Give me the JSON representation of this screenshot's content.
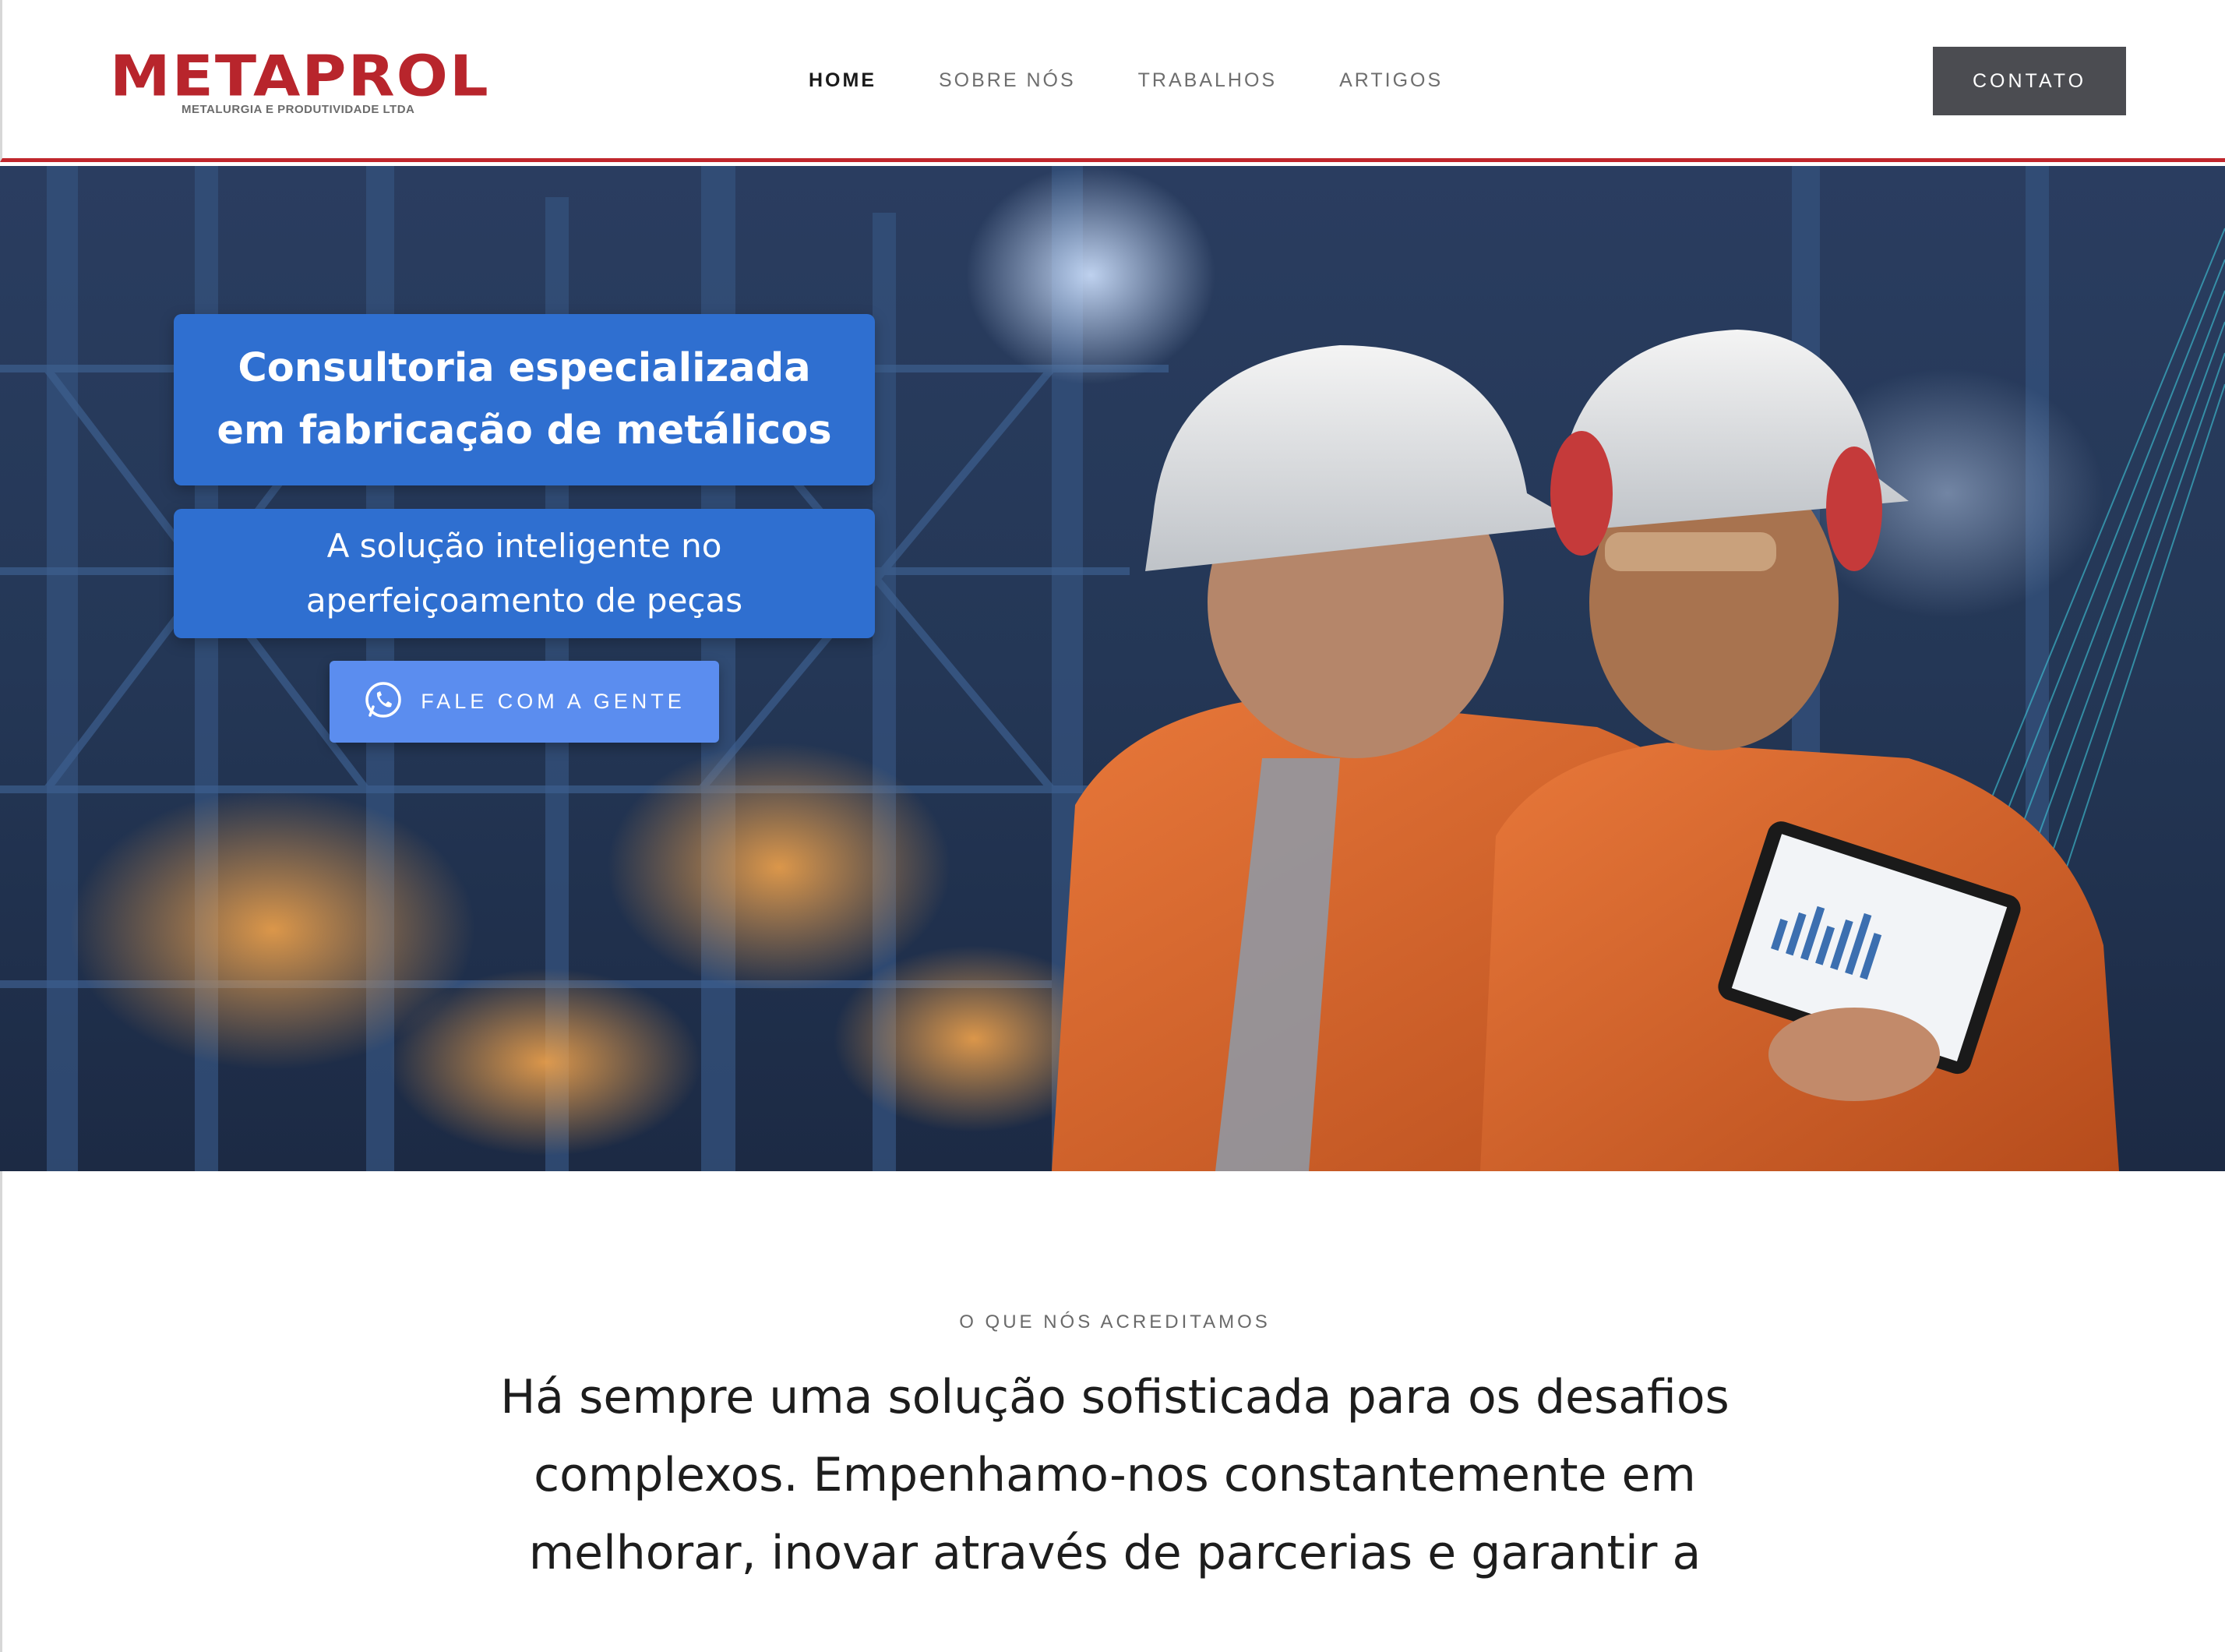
{
  "header": {
    "logo_text": "METAPROL",
    "logo_subtitle": "METALURGIA E PRODUTIVIDADE LTDA",
    "nav": [
      {
        "label": "HOME",
        "active": true
      },
      {
        "label": "SOBRE NÓS",
        "active": false
      },
      {
        "label": "TRABALHOS",
        "active": false
      },
      {
        "label": "ARTIGOS",
        "active": false
      }
    ],
    "contact_label": "CONTATO"
  },
  "hero": {
    "title": "Consultoria especializada em fabricação de metálicos",
    "subtitle": "A solução inteligente no aperfeiçoamento de peças",
    "cta_label": "FALE COM A GENTE",
    "cta_icon": "whatsapp-icon"
  },
  "belief": {
    "kicker": "O QUE NÓS ACREDITAMOS",
    "text": "Há sempre uma solução sofisticada para os desafios complexos. Empenhamo-nos constantemente em melhorar, inovar através de parcerias e garantir a"
  },
  "colors": {
    "brand_red": "#b8252c",
    "header_border": "#c0262c",
    "hero_box_blue": "#2f6fd0",
    "cta_blue": "#5b8def",
    "contact_button": "#4b4c51"
  }
}
